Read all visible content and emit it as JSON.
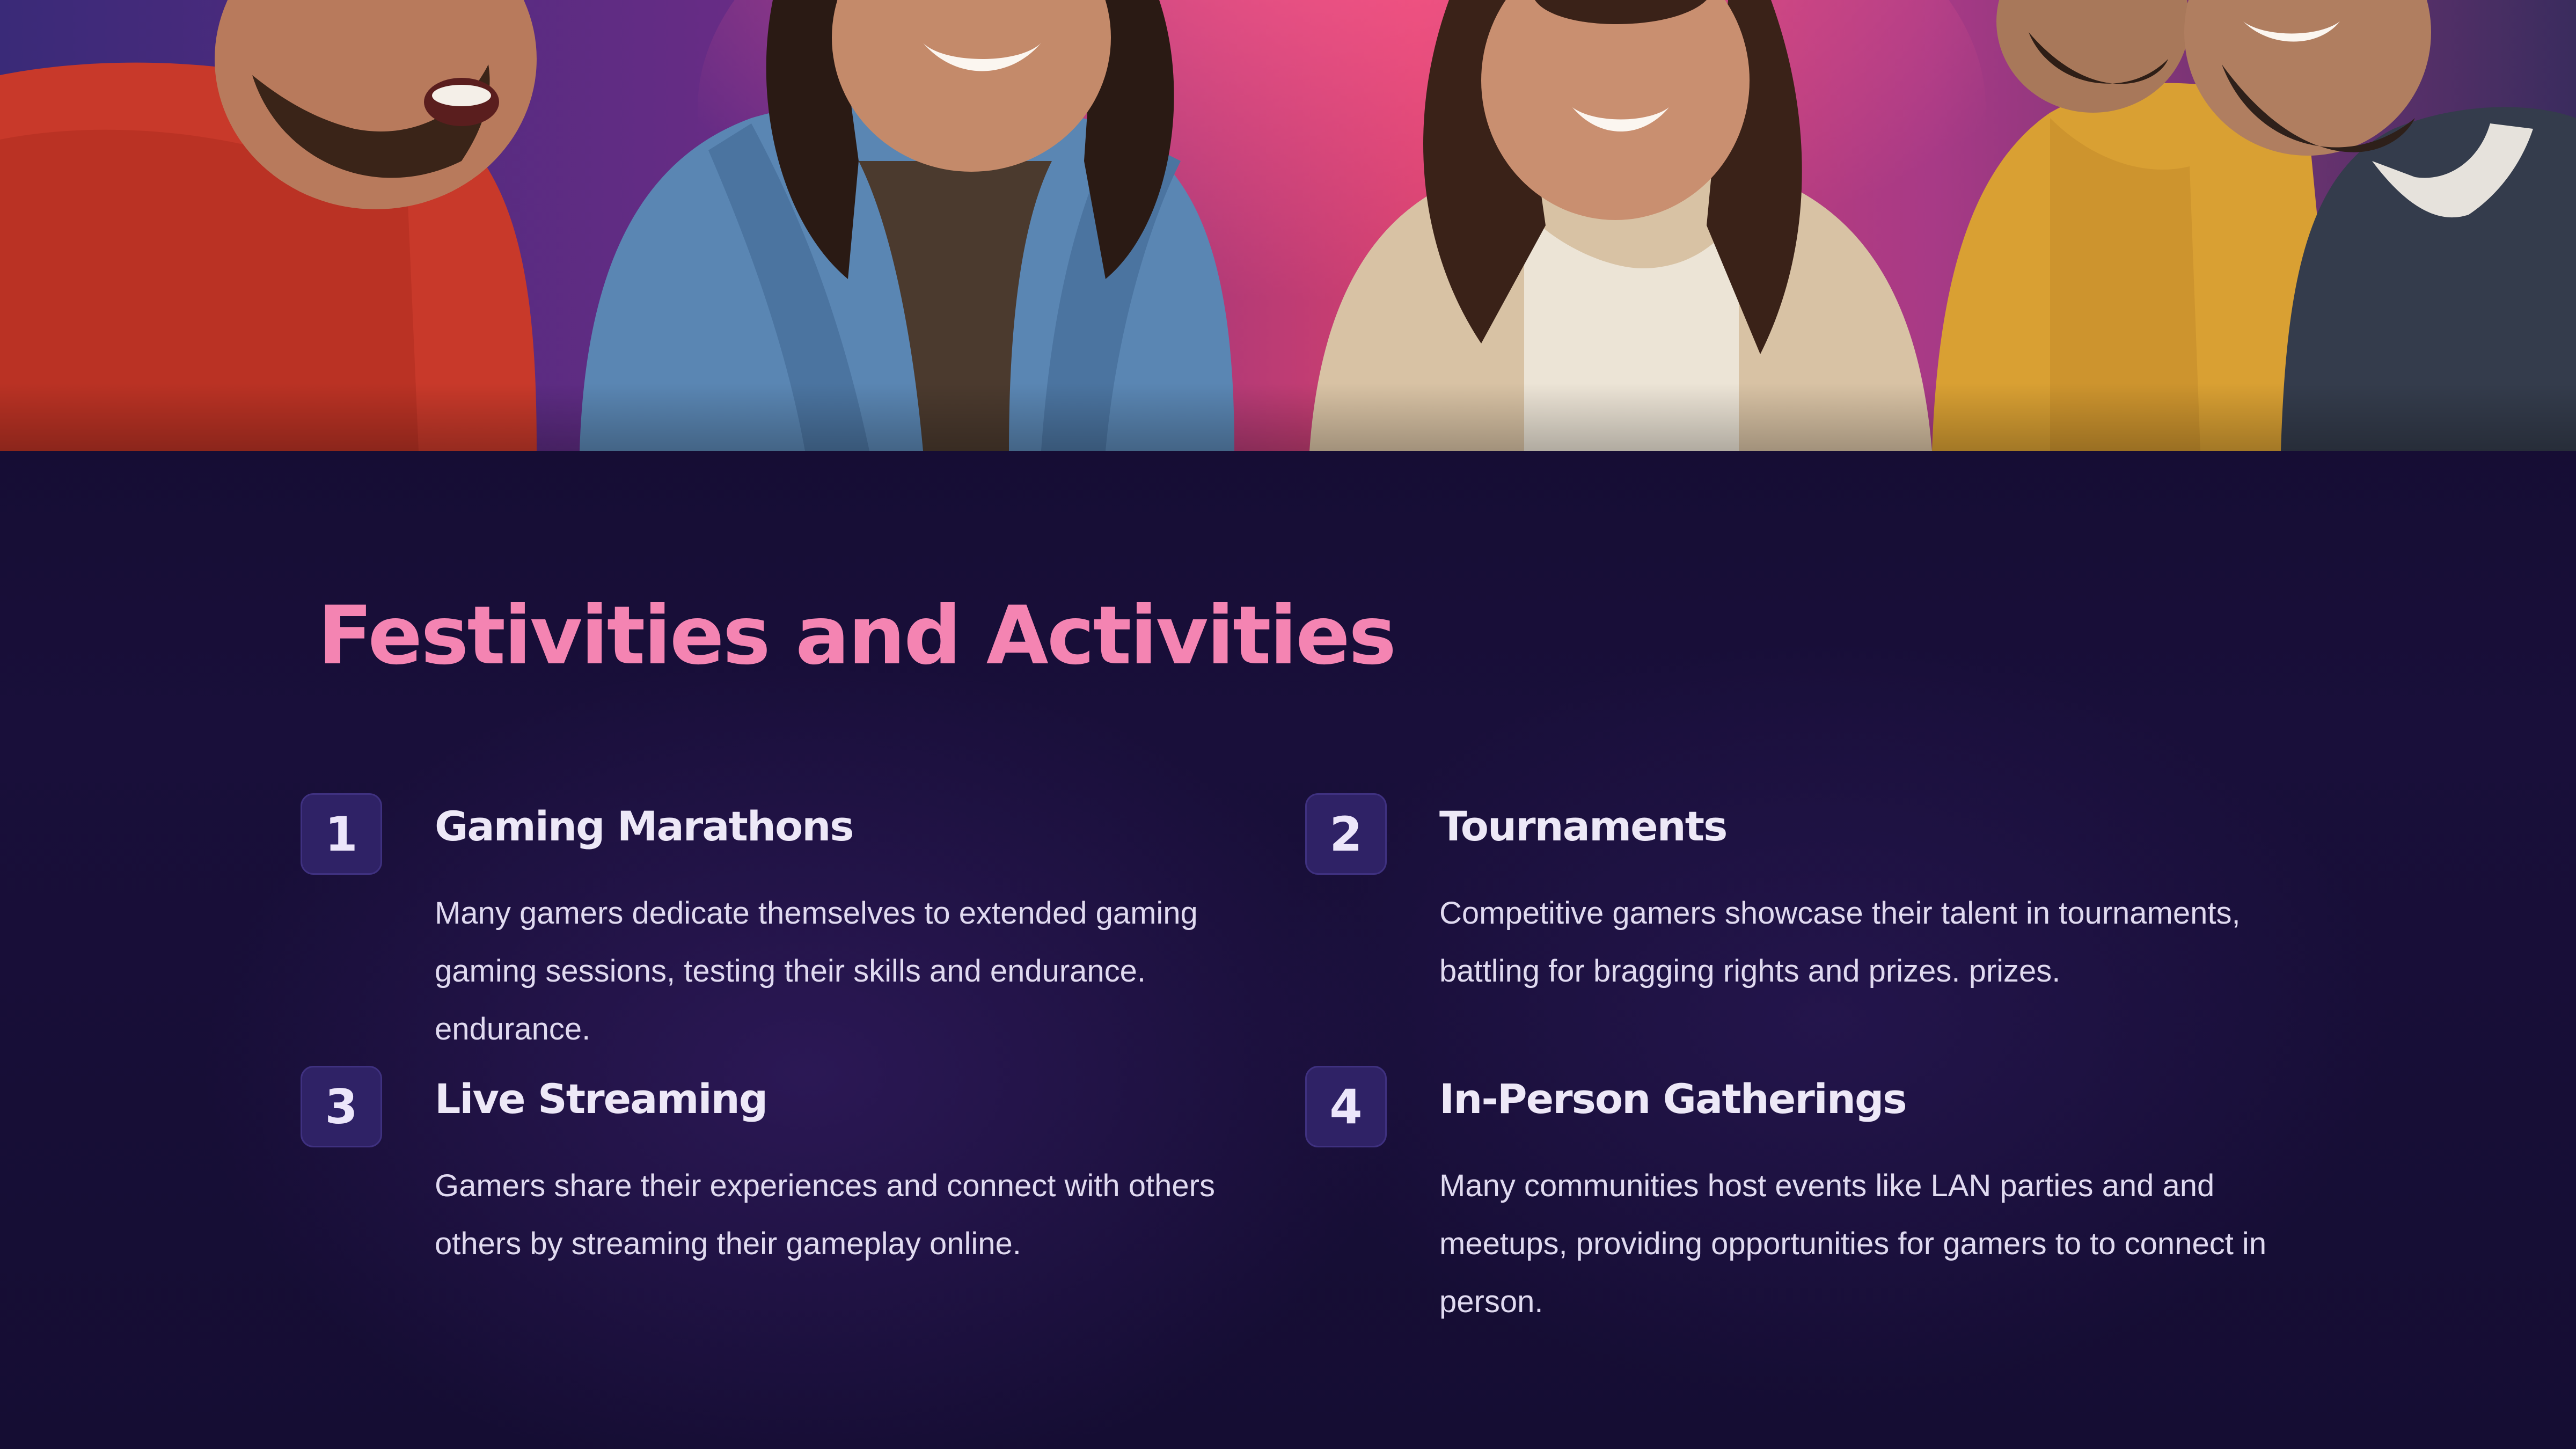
{
  "slide": {
    "title": "Festivities and Activities",
    "hero_image": "group-of-friends-laughing-photo",
    "items": [
      {
        "number": "1",
        "title": "Gaming Marathons",
        "description": "Many gamers dedicate themselves to extended gaming gaming sessions, testing their skills and endurance. endurance."
      },
      {
        "number": "2",
        "title": "Tournaments",
        "description": "Competitive gamers showcase their talent in tournaments, battling for bragging rights and prizes. prizes."
      },
      {
        "number": "3",
        "title": "Live Streaming",
        "description": "Gamers share their experiences and connect with others others by streaming their gameplay online."
      },
      {
        "number": "4",
        "title": "In-Person Gatherings",
        "description": "Many communities host events like LAN parties and and meetups, providing opportunities for gamers to to connect in person."
      }
    ]
  },
  "colors": {
    "background": "#140c30",
    "title": "#f484b2",
    "badge": "#2f2266",
    "text": "#ede8f7"
  }
}
